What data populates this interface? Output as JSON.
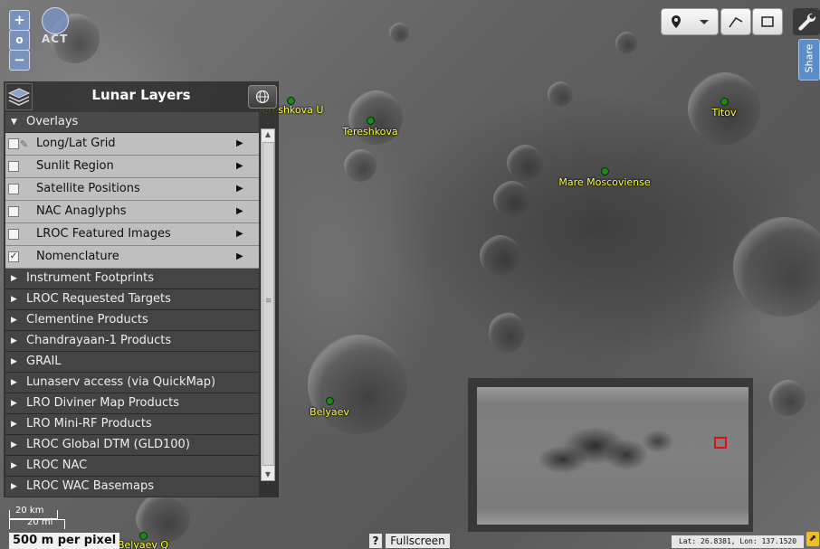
{
  "map": {
    "features": [
      {
        "name": "Tereshkova U",
        "clipped_label": "Tereshkova U"
      },
      {
        "name": "Tereshkova"
      },
      {
        "name": "Titov"
      },
      {
        "name": "Mare Moscoviense"
      },
      {
        "name": "Belyaev"
      },
      {
        "name": "Belyaev Q"
      }
    ]
  },
  "zoom": {
    "in": "+",
    "reset": "o",
    "out": "−"
  },
  "logo": {
    "text": "ACT"
  },
  "panel": {
    "title": "Lunar Layers",
    "globe_icon": "globe-icon",
    "overlays_label": "Overlays",
    "overlays": [
      {
        "label": "Long/Lat Grid",
        "checked": false,
        "pinned": true
      },
      {
        "label": "Sunlit Region",
        "checked": false
      },
      {
        "label": "Satellite Positions",
        "checked": false
      },
      {
        "label": "NAC Anaglyphs",
        "checked": false
      },
      {
        "label": "LROC Featured Images",
        "checked": false
      },
      {
        "label": "Nomenclature",
        "checked": true
      }
    ],
    "groups": [
      "Instrument Footprints",
      "LROC Requested Targets",
      "Clementine Products",
      "Chandrayaan-1 Products",
      "GRAIL",
      "Lunaserv access (via QuickMap)",
      "LRO Diviner Map Products",
      "LRO Mini-RF Products",
      "LROC Global DTM (GLD100)",
      "LROC NAC",
      "LROC WAC Basemaps"
    ]
  },
  "toolbar": {
    "pin_icon": "map-pin-icon",
    "dropdown_icon": "chevron-down-icon",
    "line_icon": "draw-line-icon",
    "rect_icon": "draw-rectangle-icon",
    "settings_icon": "wrench-icon",
    "share_label": "Share"
  },
  "scale": {
    "km": "20 km",
    "mi": "20 mi",
    "resolution": "500 m per pixel"
  },
  "bottom": {
    "help_label": "?",
    "fullscreen_label": "Fullscreen",
    "coords": "Lat: 26.8381, Lon: 137.1520"
  },
  "colors": {
    "label": "#ffff33",
    "marker": "#1a8a1a",
    "share": "#5b8ec9",
    "overview_box": "#e01010"
  }
}
